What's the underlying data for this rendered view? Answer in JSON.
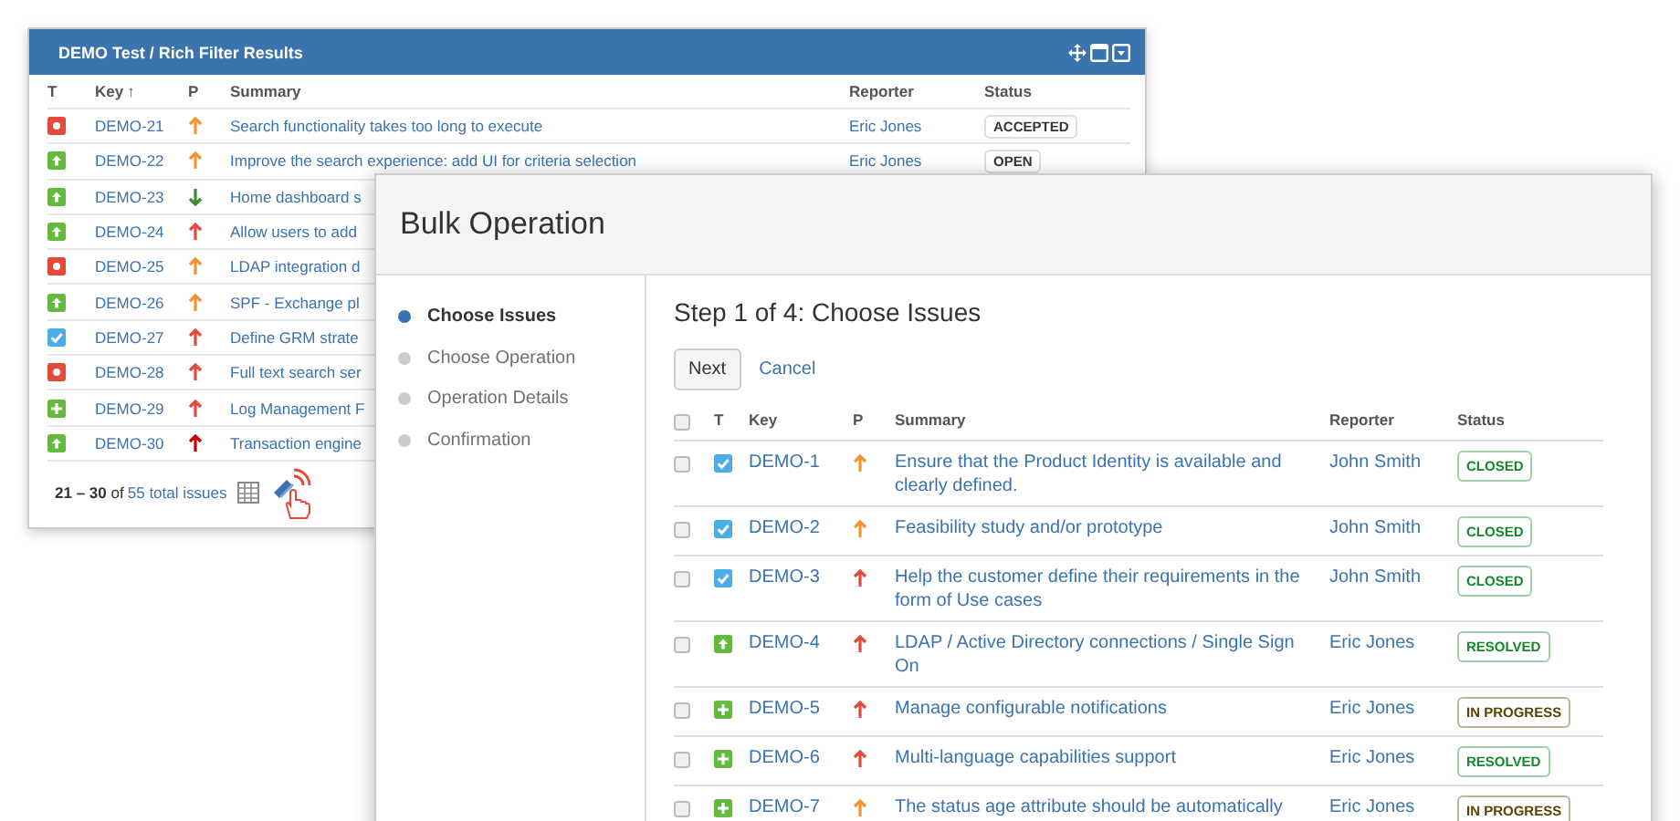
{
  "gadget": {
    "title": "DEMO Test / Rich Filter Results",
    "columns": [
      "T",
      "Key",
      "P",
      "Summary",
      "Reporter",
      "Status"
    ],
    "sort_arrow": "↑",
    "rows": [
      {
        "kind": "bug",
        "key": "DEMO-21",
        "color": "#f79232",
        "down": false,
        "summary": "Search functionality takes too long to execute",
        "reporter": "Eric Jones",
        "status": "ACCEPTED"
      },
      {
        "kind": "improvement",
        "key": "DEMO-22",
        "color": "#f79232",
        "down": false,
        "summary": "Improve the search experience: add UI for criteria selection",
        "reporter": "Eric Jones",
        "status": "OPEN"
      },
      {
        "kind": "improvement",
        "key": "DEMO-23",
        "color": "#3a8a2e",
        "down": true,
        "summary": "Home dashboard s"
      },
      {
        "kind": "improvement",
        "key": "DEMO-24",
        "color": "#e5493a",
        "down": false,
        "summary": "Allow users to add"
      },
      {
        "kind": "bug",
        "key": "DEMO-25",
        "color": "#f79232",
        "down": false,
        "summary": "LDAP integration d"
      },
      {
        "kind": "improvement",
        "key": "DEMO-26",
        "color": "#f79232",
        "down": false,
        "summary": "SPF - Exchange pl"
      },
      {
        "kind": "task",
        "key": "DEMO-27",
        "color": "#e5493a",
        "down": false,
        "summary": "Define GRM strate"
      },
      {
        "kind": "bug",
        "key": "DEMO-28",
        "color": "#e5493a",
        "down": false,
        "summary": "Full text search ser"
      },
      {
        "kind": "feature",
        "key": "DEMO-29",
        "color": "#e5493a",
        "down": false,
        "summary": "Log Management F"
      },
      {
        "kind": "improvement",
        "key": "DEMO-30",
        "color": "#cc0000",
        "down": false,
        "summary": "Transaction engine"
      }
    ],
    "footer": {
      "range": "21 – 30",
      "of": "of",
      "total": "55",
      "suffix": "total issues"
    }
  },
  "dialog": {
    "title": "Bulk Operation",
    "steps": [
      {
        "label": "Choose Issues",
        "selected": true
      },
      {
        "label": "Choose Operation",
        "selected": false
      },
      {
        "label": "Operation Details",
        "selected": false
      },
      {
        "label": "Confirmation",
        "selected": false
      }
    ],
    "heading": "Step 1 of 4: Choose Issues",
    "next_button": "Next",
    "cancel_link": "Cancel",
    "select_all": {
      "checked": false
    },
    "columns": [
      "T",
      "Key",
      "P",
      "Summary",
      "Reporter",
      "Status"
    ],
    "rows": [
      {
        "checked": false,
        "kind": "task",
        "key": "DEMO-1",
        "color": "#f79232",
        "down": false,
        "summary": "Ensure that the Product Identity is available and clearly defined.",
        "reporter": "John Smith",
        "status": {
          "text": "CLOSED",
          "color": "#14892c"
        }
      },
      {
        "checked": false,
        "kind": "task",
        "key": "DEMO-2",
        "color": "#f79232",
        "down": false,
        "summary": "Feasibility study and/or prototype",
        "reporter": "John Smith",
        "status": {
          "text": "CLOSED",
          "color": "#14892c"
        }
      },
      {
        "checked": false,
        "kind": "task",
        "key": "DEMO-3",
        "color": "#e5493a",
        "down": false,
        "summary": "Help the customer define their requirements in the form of Use cases",
        "reporter": "John Smith",
        "status": {
          "text": "CLOSED",
          "color": "#14892c"
        }
      },
      {
        "checked": false,
        "kind": "improvement",
        "key": "DEMO-4",
        "color": "#e5493a",
        "down": false,
        "summary": "LDAP / Active Directory connections / Single Sign On",
        "reporter": "Eric Jones",
        "status": {
          "text": "RESOLVED",
          "color": "#14892c"
        }
      },
      {
        "checked": false,
        "kind": "feature",
        "key": "DEMO-5",
        "color": "#e5493a",
        "down": false,
        "summary": "Manage configurable notifications",
        "reporter": "Eric Jones",
        "status": {
          "text": "IN PROGRESS",
          "color": "#594300"
        }
      },
      {
        "checked": false,
        "kind": "feature",
        "key": "DEMO-6",
        "color": "#e5493a",
        "down": false,
        "summary": "Multi-language capabilities support",
        "reporter": "Eric Jones",
        "status": {
          "text": "RESOLVED",
          "color": "#14892c"
        }
      },
      {
        "checked": false,
        "kind": "feature",
        "key": "DEMO-7",
        "color": "#f79232",
        "down": false,
        "summary": "The status age attribute should be automatically",
        "reporter": "Eric Jones",
        "status": {
          "text": "IN PROGRESS",
          "color": "#594300"
        }
      }
    ]
  }
}
